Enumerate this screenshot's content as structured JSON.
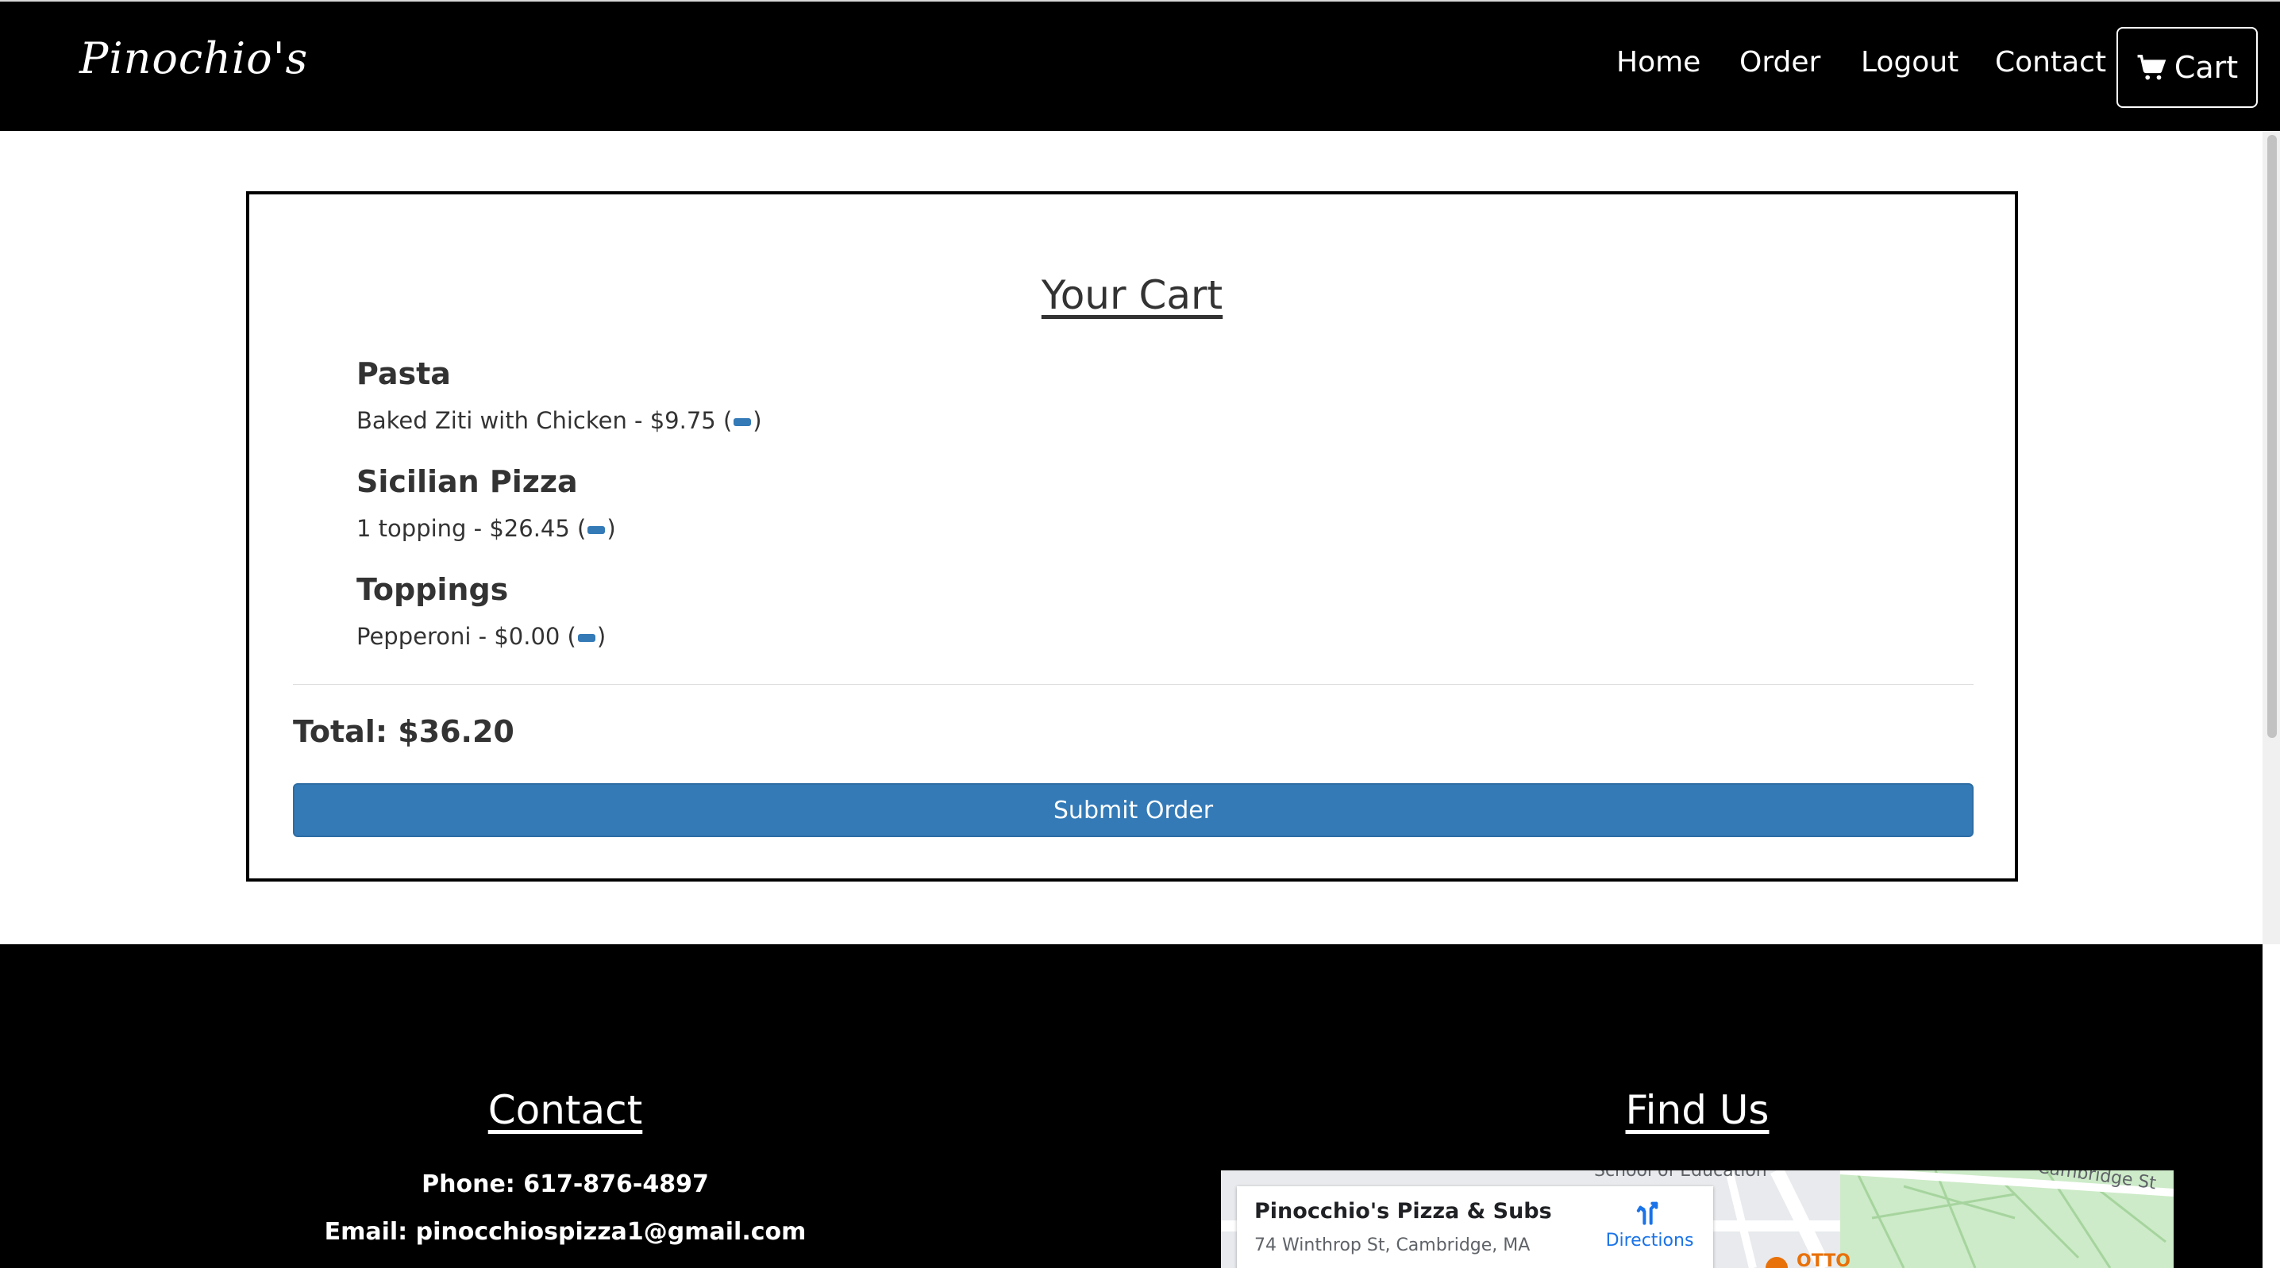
{
  "brand": "Pinochio's",
  "nav": {
    "items": [
      "Home",
      "Order",
      "Logout",
      "Contact"
    ],
    "cart_label": "Cart"
  },
  "cart": {
    "title": "Your Cart",
    "categories": [
      {
        "title": "Pasta",
        "item": "Baked Ziti with Chicken - $9.75"
      },
      {
        "title": "Sicilian Pizza",
        "item": "1 topping - $26.45"
      },
      {
        "title": "Toppings",
        "item": "Pepperoni - $0.00"
      }
    ],
    "total": "Total: $36.20",
    "submit_label": "Submit Order"
  },
  "footer": {
    "contact": {
      "heading": "Contact",
      "phone": "Phone: 617-876-4897",
      "email": "Email: pinocchiospizza1@gmail.com"
    },
    "find_us": {
      "heading": "Find Us",
      "map": {
        "place_name": "Pinocchio's Pizza & Subs",
        "address": "74 Winthrop St, Cambridge, MA",
        "directions_label": "Directions",
        "street_label": "Cambridge St",
        "poi_label": "School of Education",
        "otto_label": "OTTO"
      }
    }
  },
  "colors": {
    "nav_bg": "#000000",
    "accent": "#337ab7",
    "map_link": "#1a73e8"
  }
}
